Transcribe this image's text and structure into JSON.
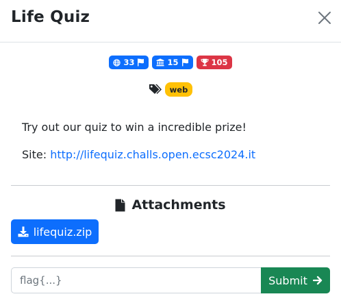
{
  "modal": {
    "title": "Life Quiz"
  },
  "stats": {
    "country_solves": "33",
    "university_solves": "15",
    "points": "105"
  },
  "tags": [
    "web"
  ],
  "description": {
    "text": "Try out our quiz to win a incredible prize!",
    "site_label": "Site:",
    "site_url": "http://lifequiz.challs.open.ecsc2024.it"
  },
  "attachments": {
    "heading": "Attachments",
    "files": [
      {
        "name": "lifequiz.zip"
      }
    ]
  },
  "flag_form": {
    "placeholder": "flag{...}",
    "value": "",
    "submit_label": "Submit"
  },
  "icons": {
    "close": "close-icon",
    "globe": "globe-icon",
    "flag": "flag-icon",
    "university": "university-icon",
    "trophy": "trophy-icon",
    "tags": "tags-icon",
    "file": "file-icon",
    "download": "download-icon",
    "arrow": "arrow-right-icon"
  },
  "colors": {
    "primary": "#0d6efd",
    "danger": "#dc3545",
    "warning": "#ffc107",
    "success": "#198754"
  }
}
